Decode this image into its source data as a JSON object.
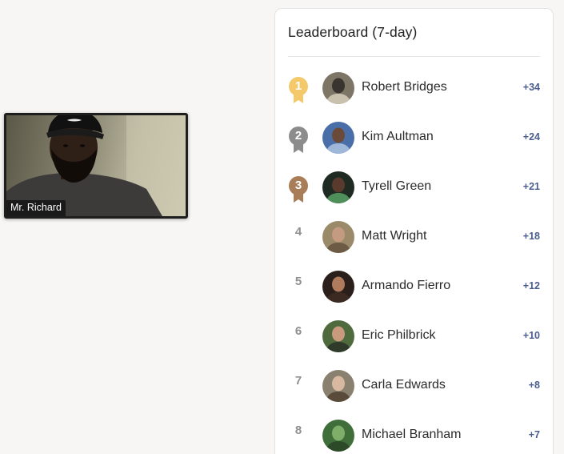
{
  "video": {
    "participant_name": "Mr. Richard"
  },
  "leaderboard": {
    "title": "Leaderboard (7-day)",
    "entries": [
      {
        "rank": "1",
        "name": "Robert Bridges",
        "score": "+34",
        "badge_color": "#f3c96b",
        "avatar_colors": [
          "#7d7566",
          "#3a3430",
          "#c9c1ad"
        ]
      },
      {
        "rank": "2",
        "name": "Kim Aultman",
        "score": "+24",
        "badge_color": "#8c8c8c",
        "avatar_colors": [
          "#4a6fa8",
          "#6b4a3a",
          "#9fb7d9"
        ]
      },
      {
        "rank": "3",
        "name": "Tyrell Green",
        "score": "+21",
        "badge_color": "#a87d58",
        "avatar_colors": [
          "#1e2a22",
          "#5a3a2c",
          "#4f8f5a"
        ]
      },
      {
        "rank": "4",
        "name": "Matt Wright",
        "score": "+18",
        "badge_color": "",
        "avatar_colors": [
          "#9a8a6a",
          "#c49a80",
          "#6e5b45"
        ]
      },
      {
        "rank": "5",
        "name": "Armando Fierro",
        "score": "+12",
        "badge_color": "",
        "avatar_colors": [
          "#2a1f1a",
          "#b07a5c",
          "#3b2a22"
        ]
      },
      {
        "rank": "6",
        "name": "Eric Philbrick",
        "score": "+10",
        "badge_color": "",
        "avatar_colors": [
          "#4f6b3e",
          "#c99a7e",
          "#2f3a2a"
        ]
      },
      {
        "rank": "7",
        "name": "Carla Edwards",
        "score": "+8",
        "badge_color": "",
        "avatar_colors": [
          "#8a8070",
          "#d8b8a0",
          "#5a4a3a"
        ]
      },
      {
        "rank": "8",
        "name": "Michael Branham",
        "score": "+7",
        "badge_color": "",
        "avatar_colors": [
          "#3f6e3a",
          "#7fae6a",
          "#2c4a28"
        ]
      }
    ]
  }
}
